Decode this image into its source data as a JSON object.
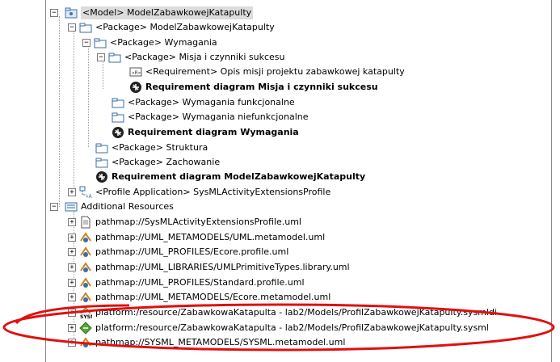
{
  "tree": [
    {
      "label": "<Model> ModelZabawkowejKatapulty",
      "icon": "model-icon",
      "toggle": "-",
      "selected": true
    },
    {
      "label": "<Package> ModelZabawkowejKatapulty",
      "icon": "package-icon",
      "toggle": "-"
    },
    {
      "label": "<Package> Wymagania",
      "icon": "package-icon",
      "toggle": "-"
    },
    {
      "label": "<Package> Misja i czynniki sukcesu",
      "icon": "package-icon",
      "toggle": "-"
    },
    {
      "label": "<Requirement> Opis misji projektu zabawkowej katapulty",
      "icon": "requirement-icon",
      "toggle": ""
    },
    {
      "label": "Requirement diagram Misja i czynniki sukcesu",
      "icon": "diagram-icon",
      "toggle": "",
      "bold": true
    },
    {
      "label": "<Package> Wymagania funkcjonalne",
      "icon": "package-icon",
      "toggle": ""
    },
    {
      "label": "<Package> Wymagania niefunkcjonalne",
      "icon": "package-icon",
      "toggle": ""
    },
    {
      "label": "Requirement diagram Wymagania",
      "icon": "diagram-icon",
      "toggle": "",
      "bold": true
    },
    {
      "label": "<Package> Struktura",
      "icon": "package-icon",
      "toggle": ""
    },
    {
      "label": "<Package> Zachowanie",
      "icon": "package-icon",
      "toggle": ""
    },
    {
      "label": "Requirement diagram ModelZabawkowejKatapulty",
      "icon": "diagram-icon",
      "toggle": "",
      "bold": true
    },
    {
      "label": "<Profile Application> SysMLActivityExtensionsProfile",
      "icon": "profile-application-icon",
      "toggle": "+"
    },
    {
      "label": "Additional Resources",
      "icon": "resources-icon",
      "toggle": "-"
    },
    {
      "label": "pathmap://SysMLActivityExtensionsProfile.uml",
      "icon": "uml-file-icon",
      "toggle": "+"
    },
    {
      "label": "pathmap://UML_METAMODELS/UML.metamodel.uml",
      "icon": "uml-resource-icon",
      "toggle": "+"
    },
    {
      "label": "pathmap://UML_PROFILES/Ecore.profile.uml",
      "icon": "uml-resource-icon",
      "toggle": "+"
    },
    {
      "label": "pathmap://UML_LIBRARIES/UMLPrimitiveTypes.library.uml",
      "icon": "uml-resource-icon",
      "toggle": "+"
    },
    {
      "label": "pathmap://UML_PROFILES/Standard.profile.uml",
      "icon": "uml-resource-icon",
      "toggle": "+"
    },
    {
      "label": "pathmap://UML_METAMODELS/Ecore.metamodel.uml",
      "icon": "uml-resource-icon",
      "toggle": "+"
    },
    {
      "label": "platform:/resource/ZabawkowaKatapulta - lab2/Models/ProfilZabawkowejKatapulty.sysmldi",
      "icon": "sysmldi-icon",
      "toggle": "+"
    },
    {
      "label": "platform:/resource/ZabawkowaKatapulta - lab2/Models/ProfilZabawkowejKatapulty.sysml",
      "icon": "sysml-model-icon",
      "toggle": "+"
    },
    {
      "label": "pathmap://SYSML_METAMODELS/SYSML.metamodel.uml",
      "icon": "uml-resource-icon",
      "toggle": "+"
    }
  ],
  "highlight_color": "#e01010"
}
